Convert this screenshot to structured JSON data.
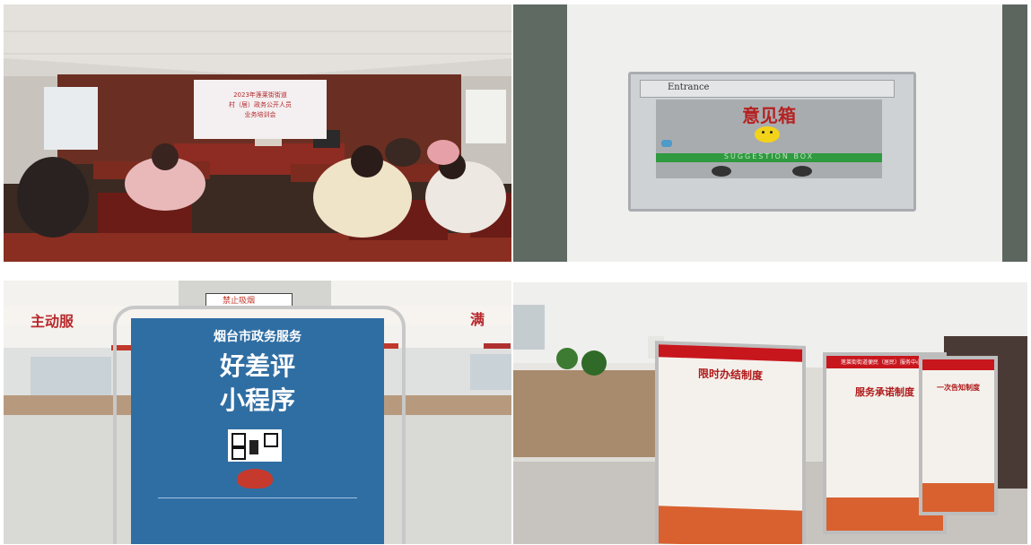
{
  "panels": {
    "training": {
      "slide_line1": "2023年莲莱街街道",
      "slide_line2": "村（居）政务公开人员",
      "slide_line3": "业务培训会"
    },
    "suggestion_box": {
      "entrance": "Entrance",
      "title": "意见箱",
      "band": "SUGGESTION BOX"
    },
    "poster": {
      "no_smoking": "禁止吸烟",
      "banner_left": "主动服",
      "banner_right": "满",
      "org": "烟台市政务服务",
      "title_line1": "好差评",
      "title_line2": "小程序",
      "colors": {
        "poster_blue": "#2f6ea3",
        "banner_red": "#b8282c"
      }
    },
    "boards": {
      "header": "莲莱街街道便民（居民）服务中心",
      "board1_title": "限时办结制度",
      "board2_title": "服务承诺制度",
      "board3_title": "一次告知制度",
      "colors": {
        "party_red": "#c8161d"
      }
    }
  }
}
